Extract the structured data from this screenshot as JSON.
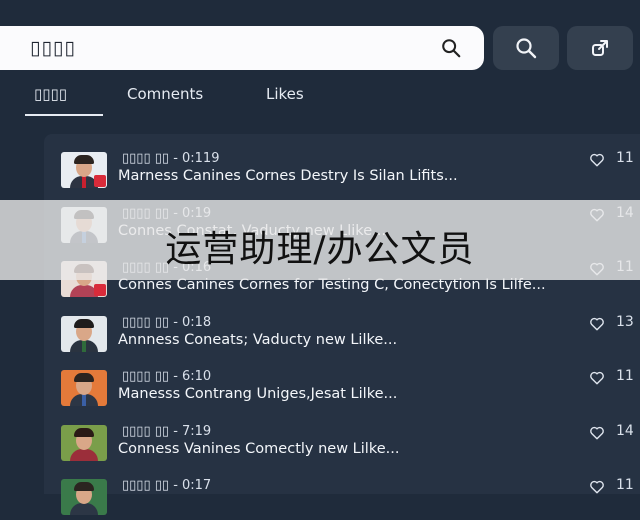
{
  "search": {
    "value": "▯▯▯▯"
  },
  "tabs": [
    {
      "label": "▯▯▯▯",
      "active": true
    },
    {
      "label": "Comnents",
      "active": false
    },
    {
      "label": "Likes",
      "active": false
    }
  ],
  "comments": [
    {
      "meta": "▯▯▯▯ ▯▯ - 0:119",
      "text": "Marness Canines Cornes Destry Is Silan Lifits...",
      "likes": "11",
      "avatar_bg": "#e8edf2",
      "avatar_shirt": "#2d3442",
      "avatar_hair": "#2b2420",
      "avatar_tie": "#c8202f",
      "badge": true
    },
    {
      "meta": "▯▯▯▯ ▯▯ - 0:19",
      "text": "Connes Constat, Vaducty new Llike...",
      "likes": "14",
      "avatar_bg": "#dfe8ef",
      "avatar_shirt": "#2f3a4c",
      "avatar_hair": "#2a2523",
      "avatar_tie": "#3b6fb5",
      "badge": false
    },
    {
      "meta": "▯▯▯▯ ▯▯ - 0:16",
      "text": "Connes Canines Cornes for Testing C, Conectytion Is Lilfe...",
      "likes": "11",
      "avatar_bg": "#e9dcd6",
      "avatar_shirt": "#b24256",
      "avatar_hair": "#4a2c20",
      "avatar_tie": "#b24256",
      "badge": true
    },
    {
      "meta": "▯▯▯▯ ▯▯ - 0:18",
      "text": "Annness Coneats; Vaducty new Lilke...",
      "likes": "13",
      "avatar_bg": "#e3e8ec",
      "avatar_shirt": "#2a3340",
      "avatar_hair": "#1e1c1c",
      "avatar_tie": "#2f6b3b",
      "badge": false
    },
    {
      "meta": "▯▯▯▯ ▯▯ - 6:10",
      "text": "Manesss Contrang Uniges,Jesat Lilke...",
      "likes": "11",
      "avatar_bg": "#e47a3a",
      "avatar_shirt": "#2c3645",
      "avatar_hair": "#2b2420",
      "avatar_tie": "#3a5fa5",
      "badge": false
    },
    {
      "meta": "▯▯▯▯ ▯▯ - 7:19",
      "text": "Conness Vanines Comectly new Lilke...",
      "likes": "14",
      "avatar_bg": "#7a9e4a",
      "avatar_shirt": "#9b2e3a",
      "avatar_hair": "#2a1a16",
      "avatar_tie": "#9b2e3a",
      "badge": false
    },
    {
      "meta": "▯▯▯▯ ▯▯ - 0:17",
      "text": "",
      "likes": "11",
      "avatar_bg": "#3a7a4a",
      "avatar_shirt": "#2c3645",
      "avatar_hair": "#2b2420",
      "avatar_tie": "#2c3645",
      "badge": false
    }
  ],
  "overlay": {
    "text": "运营助理/办公文员"
  },
  "icons": {
    "search": "search-icon",
    "share": "share-icon",
    "like": "heart-icon"
  }
}
